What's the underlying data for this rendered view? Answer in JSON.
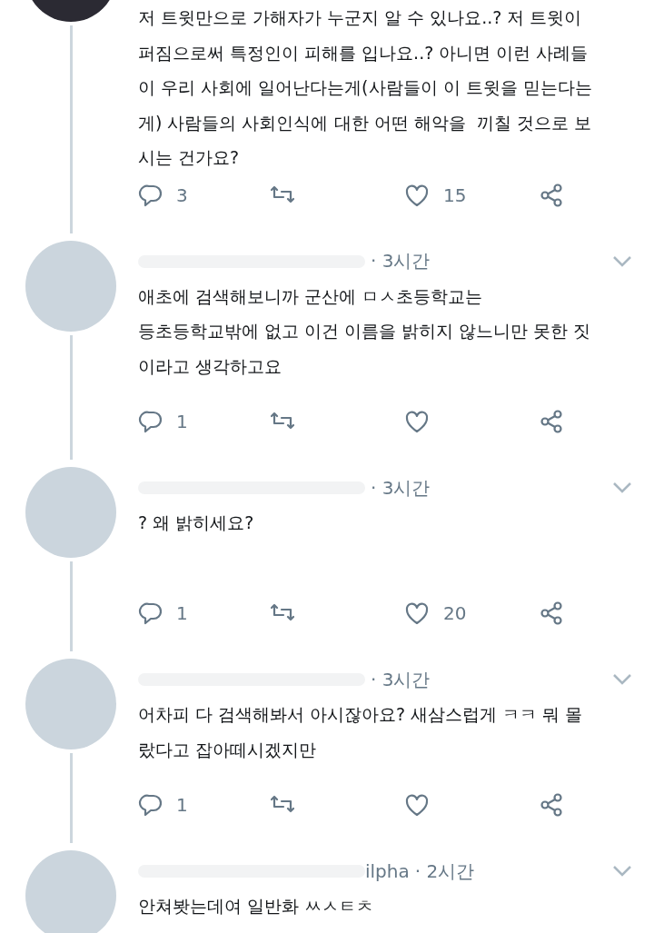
{
  "tweets": [
    {
      "text": "저 트윗만으로 가해자가 누군지 알 수 있나요..? 저 트윗이 퍼짐으로써 특정인이 피해를 입나요..? 아니면 이런 사례들이 우리 사회에 일어난다는게(사람들이 이 트윗을 믿는다는게) 사람들의 사회인식에 대한 어떤 해악을  끼칠 것으로 보시는 건가요?",
      "reply_count": "3",
      "like_count": "15",
      "actions_shown": true
    },
    {
      "time": "· 3시간",
      "text": "애초에 검색해보니까 군산에 ㅁㅅ초등학교는\n등초등학교밖에 없고 이건 이름을 밝히지 않느니만 못한 짓이라고 생각하고요",
      "reply_count": "1",
      "actions_shown": true
    },
    {
      "time": "· 3시간",
      "text": "? 왜 밝히세요?",
      "reply_count": "1",
      "like_count": "20",
      "actions_shown": true
    },
    {
      "time": "· 3시간",
      "text": "어차피 다 검색해봐서 아시잖아요? 새삼스럽게 ㅋㅋ 뭐 몰랐다고 잡아떼시겠지만",
      "reply_count": "1",
      "actions_shown": true
    },
    {
      "handle": "ilpha",
      "time": "· 2시간",
      "text": "안쳐봣는데여 일반화 ㅆㅅㅌㅊ",
      "actions_shown": false
    }
  ]
}
